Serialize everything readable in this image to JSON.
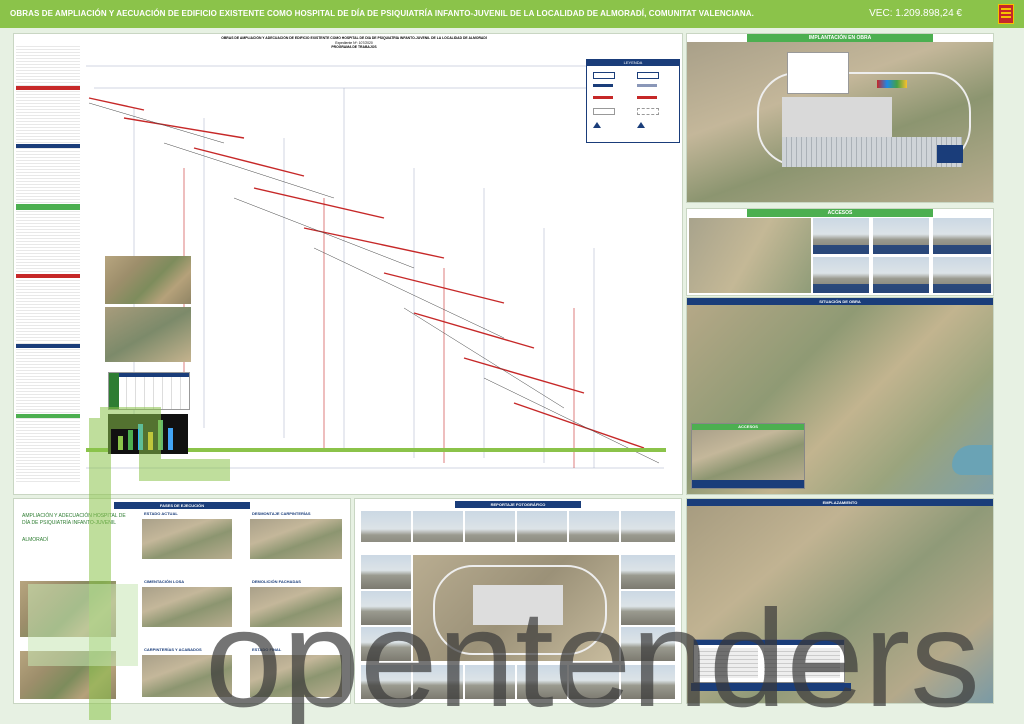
{
  "header": {
    "title": "OBRAS DE AMPLIACIÓN Y AECUACIÓN DE EDIFICIO EXISTENTE COMO HOSPITAL DE DÍA DE PSIQUIATRÍA INFANTO-JUVENIL DE LA LOCALIDAD DE ALMORADÍ, COMUNITAT VALENCIANA.",
    "price": "VEC: 1.209.898,24 €"
  },
  "gantt": {
    "title_line1": "OBRAS DE AMPLIACIÓN Y ADECUACIÓN DE EDIFICIO EXISTENTE COMO HOSPITAL DE DÍA DE PSIQUIATRÍA INFANTO-JUVENIL DE LA LOCALIDAD DE ALMORADÍ",
    "title_line2": "Expediente Nº: 107/2020",
    "title_line3": "PROGRAMA DE TRABAJOS",
    "legend_title": "LEYENDA"
  },
  "implantacion": {
    "title": "IMPLANTACIÓN EN OBRA"
  },
  "accesos": {
    "title": "ACCESOS"
  },
  "situacion": {
    "title": "SITUACIÓN DE OBRA",
    "inset_title": "ACCESOS"
  },
  "fases": {
    "title": "FASES DE EJECUCIÓN",
    "project_name": "AMPLIACIÓN Y ADECUACIÓN HOSPITAL DE DÍA DE PSIQUIATRÍA INFANTO-JUVENIL",
    "town": "ALMORADÍ",
    "labels": [
      "ESTADO ACTUAL",
      "DESMONTAJE CARPINTERÍAS",
      "CIMENTACIÓN LOSA",
      "DEMOLICIÓN FACHADAS",
      "CARPINTERÍAS Y ACABADOS",
      "ESTADO FINAL"
    ]
  },
  "reportaje": {
    "title": "REPORTAJE FOTOGRÁFICO"
  },
  "emplazamiento": {
    "title": "EMPLAZAMIENTO"
  },
  "watermark": {
    "text": "opentenders"
  },
  "colors": {
    "accent": "#8bc34a",
    "navy": "#1a3d7a",
    "gantt_bar": "#c62828",
    "sat": "#9d8e6b"
  }
}
